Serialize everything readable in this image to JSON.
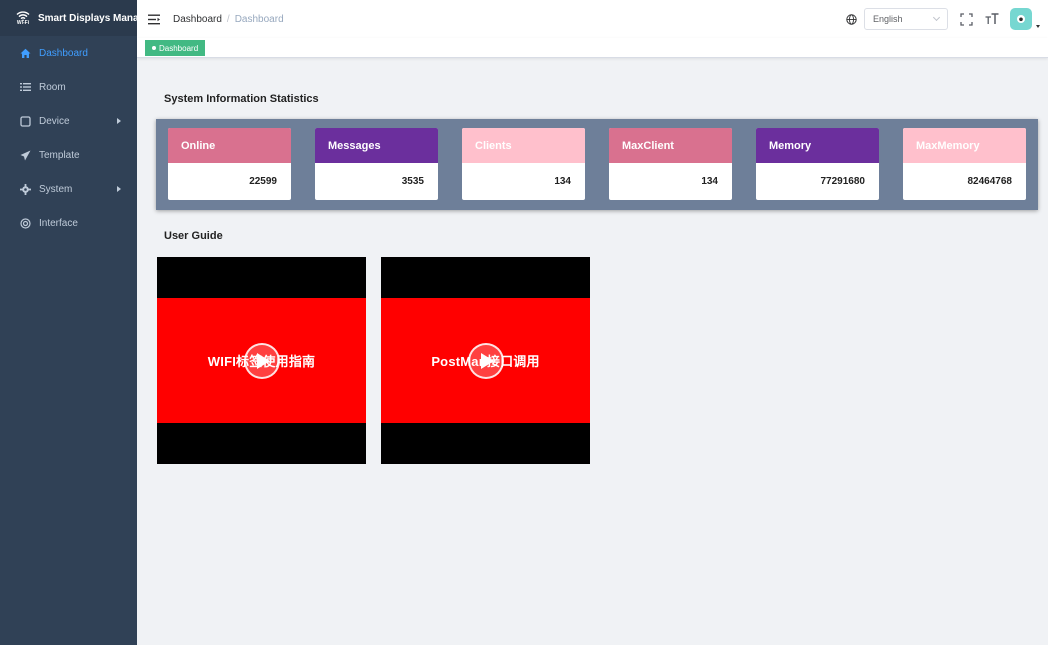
{
  "app": {
    "title": "Smart Displays Manager",
    "logo_text": "Wi-Fi",
    "logo_icon": "wifi-icon"
  },
  "sidebar": {
    "items": [
      {
        "label": "Dashboard",
        "icon": "home-icon",
        "active": true
      },
      {
        "label": "Room",
        "icon": "list-icon"
      },
      {
        "label": "Device",
        "icon": "device-icon",
        "has_submenu": true
      },
      {
        "label": "Template",
        "icon": "send-icon"
      },
      {
        "label": "System",
        "icon": "gear-icon",
        "has_submenu": true
      },
      {
        "label": "Interface",
        "icon": "interface-icon"
      }
    ]
  },
  "header": {
    "breadcrumb": {
      "home": "Dashboard",
      "separator": "/",
      "current": "Dashboard"
    },
    "language": "English"
  },
  "tags": [
    {
      "label": "Dashboard",
      "active": true
    }
  ],
  "stats": {
    "title": "System Information Statistics",
    "cards": [
      {
        "label": "Online",
        "value": "22599",
        "color": "#d9718f"
      },
      {
        "label": "Messages",
        "value": "3535",
        "color": "#6b2f9d"
      },
      {
        "label": "Clients",
        "value": "134",
        "color": "#ffc0cc"
      },
      {
        "label": "MaxClient",
        "value": "134",
        "color": "#d9718f"
      },
      {
        "label": "Memory",
        "value": "77291680",
        "color": "#6b2f9d"
      },
      {
        "label": "MaxMemory",
        "value": "82464768",
        "color": "#ffc0cc"
      }
    ]
  },
  "guide": {
    "title": "User Guide",
    "videos": [
      {
        "title": "WIFI标签使用指南"
      },
      {
        "title": "PostMan接口调用"
      }
    ]
  },
  "colors": {
    "sidebar_bg": "#304156",
    "active_menu": "#409eff",
    "tag_green": "#42b983",
    "video_red": "#ff0000"
  }
}
